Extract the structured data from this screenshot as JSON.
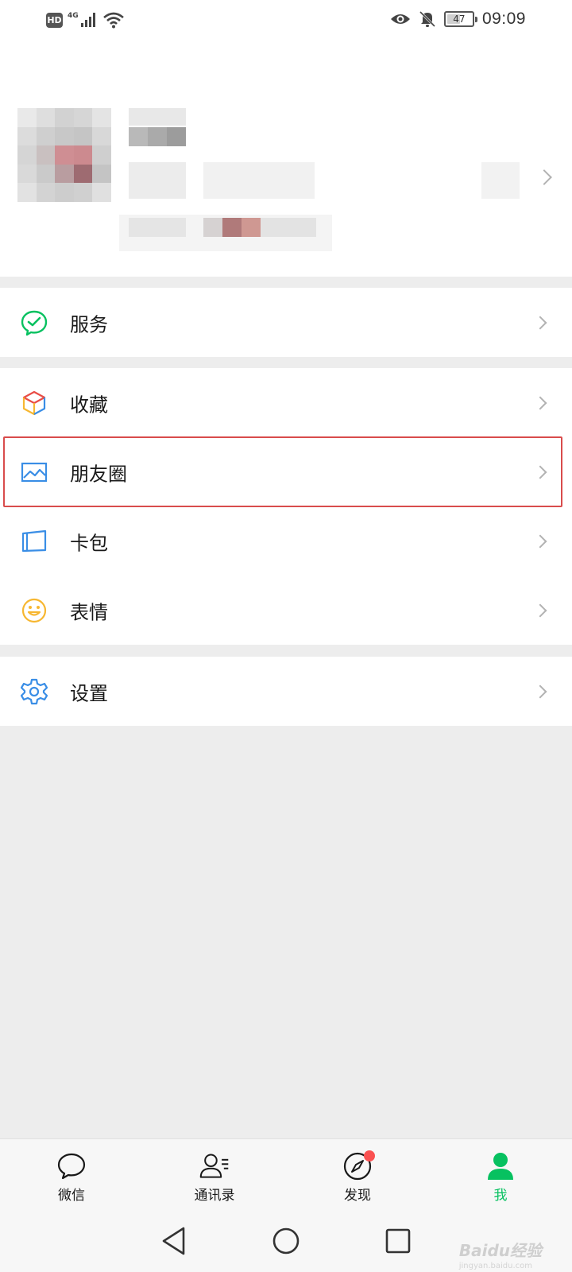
{
  "status_bar": {
    "hd": "HD",
    "network": "4G",
    "battery": "47",
    "battery_level": 0.47,
    "time": "09:09"
  },
  "menu": {
    "group1": [
      {
        "label": "服务",
        "icon": "wechat-pay-icon"
      }
    ],
    "group2": [
      {
        "label": "收藏",
        "icon": "favorites-cube-icon"
      },
      {
        "label": "朋友圈",
        "icon": "moments-image-icon"
      },
      {
        "label": "卡包",
        "icon": "card-wallet-icon"
      },
      {
        "label": "表情",
        "icon": "smiley-icon"
      }
    ],
    "group3": [
      {
        "label": "设置",
        "icon": "gear-icon"
      }
    ]
  },
  "tabbar": {
    "tabs": [
      {
        "label": "微信",
        "icon": "chat-bubble-icon",
        "active": false
      },
      {
        "label": "通讯录",
        "icon": "contacts-icon",
        "active": false
      },
      {
        "label": "发现",
        "icon": "compass-icon",
        "active": false,
        "badge": true
      },
      {
        "label": "我",
        "icon": "person-icon",
        "active": true
      }
    ]
  },
  "watermark": {
    "text": "Baidu经验",
    "sub": "jingyan.baidu.com"
  },
  "colors": {
    "accent_green": "#07c160",
    "highlight_red": "#d94c4c",
    "badge_red": "#fa5151"
  }
}
